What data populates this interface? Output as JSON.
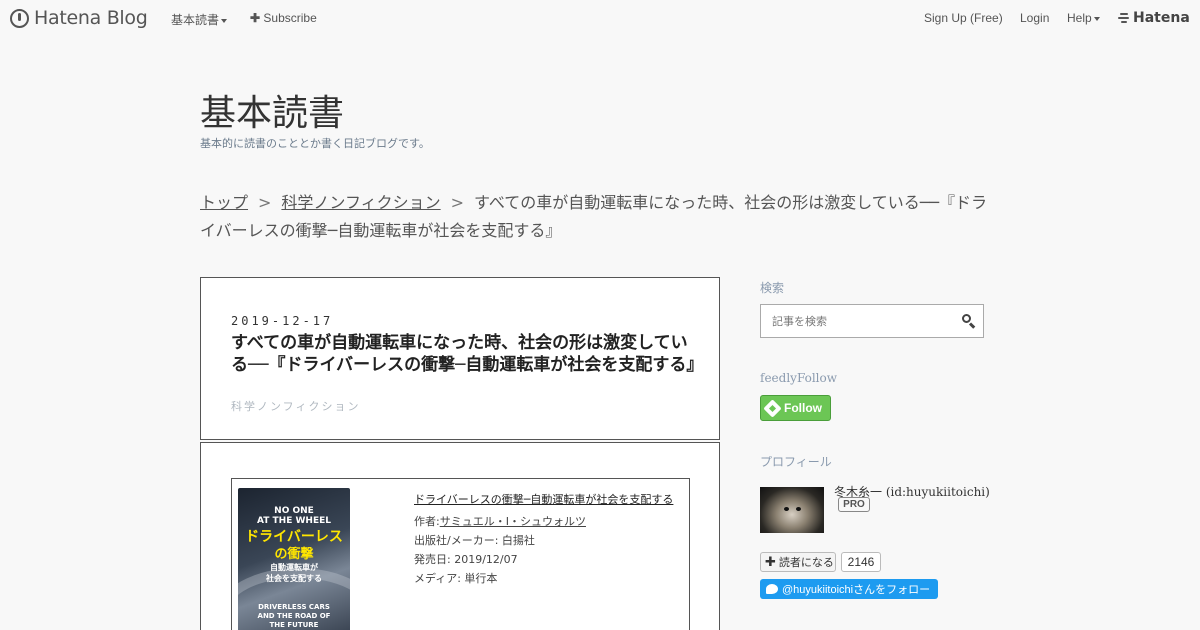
{
  "topbar": {
    "logo": "Hatena Blog",
    "blog_menu": "基本読書",
    "subscribe": "Subscribe",
    "signup": "Sign Up (Free)",
    "login": "Login",
    "help": "Help",
    "hatena": "Hatena"
  },
  "blog": {
    "title": "基本読書",
    "description": "基本的に読書のこととか書く日記ブログです。"
  },
  "breadcrumb": {
    "top": "トップ",
    "separator": ">",
    "category": "科学ノンフィクション",
    "current": "すべての車が自動運転車になった時、社会の形は激変している──『ドライバーレスの衝撃─自動運転車が社会を支配する』"
  },
  "entry": {
    "date": "2019-12-17",
    "title": "すべての車が自動運転車になった時、社会の形は激変している──『ドライバーレスの衝撃─自動運転車が社会を支配する』",
    "category": "科学ノンフィクション"
  },
  "book": {
    "title": "ドライバーレスの衝撃─自動運転車が社会を支配する",
    "author_label": "作者:",
    "author": "サミュエル・I・シュウォルツ",
    "publisher": "出版社/メーカー: 白揚社",
    "release": "発売日: 2019/12/07",
    "media": "メディア: 単行本",
    "cover": {
      "line1": "NO ONE",
      "line2": "AT THE WHEEL",
      "line3": "ドライバーレス",
      "line4": "の衝撃",
      "line5": "自動運転車が",
      "line6": "社会を支配する",
      "line7": "DRIVERLESS CARS",
      "line8": "AND THE ROAD OF",
      "line9": "THE FUTURE"
    }
  },
  "sidebar": {
    "search_heading": "検索",
    "search_placeholder": "記事を検索",
    "feedly_heading": "feedlyFollow",
    "feedly_button": "Follow",
    "profile_heading": "プロフィール",
    "profile_name": "冬木糸一 (id:huyukiitoichi)",
    "pro_badge": "PRO",
    "reader_button": "読者になる",
    "reader_count": "2146",
    "twitter_button": "@huyukiitoichiさんをフォロー"
  },
  "colors": {
    "background": "#f8f8f8",
    "feedly_green": "#6cc655",
    "twitter_blue": "#1d9bf0",
    "sidebar_heading": "#8a9aae"
  }
}
